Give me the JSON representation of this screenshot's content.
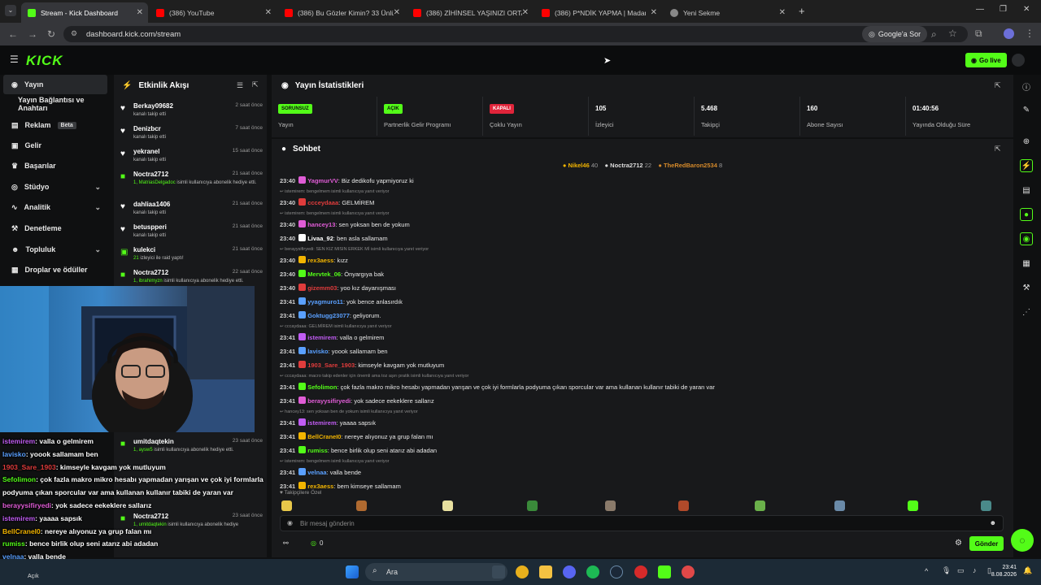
{
  "browser": {
    "tabs": [
      {
        "label": "Stream - Kick Dashboard",
        "active": true
      },
      {
        "label": "(386) YouTube"
      },
      {
        "label": "(386) Bu Gözler Kimin? 33 Ünlü"
      },
      {
        "label": "(386) ZİHİNSEL YAŞINIZI ORTAYA"
      },
      {
        "label": "(386) P*NDİK YAPMA | Madara"
      },
      {
        "label": "Yeni Sekme"
      }
    ],
    "url": "dashboard.kick.com/stream",
    "google_lens": "Google'a Sor"
  },
  "kick": {
    "logo": "KICK",
    "go_live": "Go live"
  },
  "sidebar": {
    "items": [
      {
        "label": "Yayın",
        "active": true
      },
      {
        "label": "Yayın Bağlantısı ve Anahtarı"
      },
      {
        "label": "Reklam",
        "badge": "Beta"
      },
      {
        "label": "Gelir"
      },
      {
        "label": "Başarılar"
      },
      {
        "label": "Stüdyo"
      },
      {
        "label": "Analitik"
      },
      {
        "label": "Denetleme"
      },
      {
        "label": "Topluluk"
      },
      {
        "label": "Droplar ve ödüller"
      }
    ]
  },
  "activity": {
    "title": "Etkinlik Akışı",
    "items": [
      {
        "name": "Berkay09682",
        "time": "2 saat önce",
        "sub": "kanalı takip etti",
        "icon": "heart"
      },
      {
        "name": "Denizbcr",
        "time": "7 saat önce",
        "sub": "kanalı takip etti",
        "icon": "heart"
      },
      {
        "name": "yekranel",
        "time": "15 saat önce",
        "sub": "kanalı takip etti",
        "icon": "heart"
      },
      {
        "name": "Noctra2712",
        "time": "21 saat önce",
        "sub_hl": "1, MatriasDelgadoc",
        "sub": " isimli kullanıcıya abonelik hediye etti.",
        "icon": "gift"
      },
      {
        "name": "dahliaa1406",
        "time": "21 saat önce",
        "sub": "kanalı takip etti",
        "icon": "heart"
      },
      {
        "name": "betuspperi",
        "time": "21 saat önce",
        "sub": "kanalı takip etti",
        "icon": "heart"
      },
      {
        "name": "kulekci",
        "time": "21 saat önce",
        "sub_hl": "21",
        "sub": " izleyici ile raid yaptı!",
        "icon": "raid"
      },
      {
        "name": "Noctra2712",
        "time": "22 saat önce",
        "sub_hl": "1, ibrahimyzn",
        "sub": " isimli kullanıcıya abonelik hediye etti.",
        "icon": "gift"
      },
      {
        "name": "umitdaqtekin",
        "time": "23 saat önce",
        "sub_hl": "1, aysw5",
        "sub": " isimli kullanıcıya abonelik hediye etti.",
        "icon": "gift"
      },
      {
        "name": "Noctra2712",
        "time": "23 saat önce",
        "sub_hl": "1, umitdaqtekin",
        "sub": " isimli kullanıcıya abonelik hediye",
        "icon": "gift"
      }
    ]
  },
  "stats": {
    "title": "Yayın İstatistikleri",
    "cells": [
      {
        "badge": "SORUNSUZ",
        "label": "Yayın",
        "badge_color": "#53fc18"
      },
      {
        "badge": "AÇIK",
        "label": "Partnerlik Gelir Programı",
        "badge_color": "#53fc18"
      },
      {
        "badge": "KAPALI",
        "label": "Çoklu Yayın",
        "badge_color": "#e0243a"
      },
      {
        "value": "105",
        "label": "İzleyici"
      },
      {
        "value": "5.468",
        "label": "Takipçi"
      },
      {
        "value": "160",
        "label": "Abone Sayısı"
      },
      {
        "value": "01:40:56",
        "label": "Yayında Olduğu Süre"
      }
    ]
  },
  "chat": {
    "title": "Sohbet",
    "top_gifters": [
      {
        "name": "Nikel46",
        "count": "40",
        "color": "#f2b400"
      },
      {
        "name": "Noctra2712",
        "count": "22",
        "color": "#dddddd"
      },
      {
        "name": "TheRedBaron2534",
        "count": "8",
        "color": "#d4892a"
      }
    ],
    "messages": [
      {
        "type": "msg",
        "time": "23:40",
        "user": "YagmurVV",
        "color": "#e05cd6",
        "text": "Biz dedikofu yapmiyoruz ki"
      },
      {
        "type": "reply",
        "text": "istemirem: bengelmem isimli kullanıcıya yanıt veriyor"
      },
      {
        "type": "msg",
        "time": "23:40",
        "user": "ccceydaaa",
        "color": "#e03c3c",
        "text": "GELMİREM"
      },
      {
        "type": "reply",
        "text": "istemirem: bengelmem isimli kullanıcıya yanıt veriyor"
      },
      {
        "type": "msg",
        "time": "23:40",
        "user": "hancey13",
        "color": "#e05cd6",
        "text": "sen yoksan ben de yokum"
      },
      {
        "type": "msg",
        "time": "23:40",
        "user": "Livaa_92",
        "color": "#ffffff",
        "text": "ben asla sallamam"
      },
      {
        "type": "reply",
        "text": "berayysifiryedi: SEN KIZ MISIN ERKEK Mİ isimli kullanıcıya yanıt veriyor"
      },
      {
        "type": "msg",
        "time": "23:40",
        "user": "rex3aess",
        "color": "#f2b400",
        "text": "kızz"
      },
      {
        "type": "msg",
        "time": "23:40",
        "user": "Mervtek_06",
        "color": "#53fc18",
        "text": "Önyargıya bak"
      },
      {
        "type": "msg",
        "time": "23:40",
        "user": "gizemm03",
        "color": "#e03c3c",
        "text": "yoo kız dayanışması"
      },
      {
        "type": "msg",
        "time": "23:41",
        "user": "yyagmuro11",
        "color": "#5aa0ff",
        "text": "yok bence anlasırdık"
      },
      {
        "type": "msg",
        "time": "23:41",
        "user": "Goktugg23077",
        "color": "#5aa0ff",
        "text": "geliyorum."
      },
      {
        "type": "reply",
        "text": "cccaydaaa: GELMİREM isimli kullanıcıya yanıt veriyor"
      },
      {
        "type": "msg",
        "time": "23:41",
        "user": "istemirem",
        "color": "#c05cf2",
        "text": "valla o gelmirem"
      },
      {
        "type": "msg",
        "time": "23:41",
        "user": "lavisko",
        "color": "#5aa0ff",
        "text": "yoook sallamam ben"
      },
      {
        "type": "msg",
        "time": "23:41",
        "user": "1903_Sare_1903",
        "color": "#e03c3c",
        "text": "kimseyle kavgam yok mutluyum"
      },
      {
        "type": "reply",
        "text": "cccaydaaa: macro takip edenler için önemli ama toz aşırı pratik isimli kullanıcıya yanıt veriyor"
      },
      {
        "type": "msg",
        "time": "23:41",
        "user": "Sefolimon",
        "color": "#53fc18",
        "text": "çok fazla makro mikro hesabı yapmadan yarışan ve çok iyi formlarla podyuma çıkan sporcular var ama kullanan kullanır tabiki de yaran var"
      },
      {
        "type": "msg",
        "time": "23:41",
        "user": "berayysifiryedi",
        "color": "#e05cd6",
        "text": "yok sadece eekeklere sallarız"
      },
      {
        "type": "reply",
        "text": "hancey13: sen yoksan ben de yokum isimli kullanıcıya yanıt veriyor"
      },
      {
        "type": "msg",
        "time": "23:41",
        "user": "istemirem",
        "color": "#c05cf2",
        "text": "yaaaa sapsık"
      },
      {
        "type": "msg",
        "time": "23:41",
        "user": "BellCraneI0",
        "color": "#f2b400",
        "text": "nereye alıyonuz ya grup falan mı"
      },
      {
        "type": "msg",
        "time": "23:41",
        "user": "rumiss",
        "color": "#53fc18",
        "text": "bence birlik olup seni atarız abi adadan"
      },
      {
        "type": "reply",
        "text": "istemirem: bengelmem isimli kullanıcıya yanıt veriyor"
      },
      {
        "type": "msg",
        "time": "23:41",
        "user": "velnaa",
        "color": "#5aa0ff",
        "text": "valla bende"
      },
      {
        "type": "msg",
        "time": "23:41",
        "user": "rex3aess",
        "color": "#f2b400",
        "text": "bem kimseye sallamam"
      }
    ],
    "follower_special": "Takipçilere Özel",
    "input_placeholder": "Bir mesaj gönderin",
    "points": "0",
    "send": "Gönder"
  },
  "overlay": {
    "lines": [
      {
        "user": "istemirem",
        "color": "#c05cf2",
        "text": ": valla o gelmirem"
      },
      {
        "user": "lavisko",
        "color": "#5aa0ff",
        "text": ": yoook sallamam ben"
      },
      {
        "user": "1903_Sare_1903",
        "color": "#e03c3c",
        "text": ": kimseyle kavgam yok mutluyum"
      },
      {
        "user": "Sefolimon",
        "color": "#53fc18",
        "text": ": çok fazla makro mikro hesabı yapmadan yarışan ve çok iyi formlarla"
      },
      {
        "user": "",
        "color": "#ffffff",
        "text": "podyuma çıkan sporcular var ama kullanan kullanır tabiki de yaran var"
      },
      {
        "user": "berayysifiryedi",
        "color": "#e05cd6",
        "text": ": yok sadece eekeklere sallarız"
      },
      {
        "user": "istemirem",
        "color": "#c05cf2",
        "text": ": yaaaa sapsık"
      },
      {
        "user": "BellCraneI0",
        "color": "#f2b400",
        "text": ": nereye alıyonuz ya grup falan mı"
      },
      {
        "user": "rumiss",
        "color": "#53fc18",
        "text": ": bence birlik olup seni atarız abi adadan"
      },
      {
        "user": "velnaa",
        "color": "#5aa0ff",
        "text": ": valla bende"
      },
      {
        "user": "rex3aess",
        "color": "#f2b400",
        "text": ": bem kimseye sallamam"
      }
    ],
    "status": "Açık"
  },
  "taskbar": {
    "search": "Ara",
    "time": "23:41",
    "date": "8.08.2026"
  }
}
